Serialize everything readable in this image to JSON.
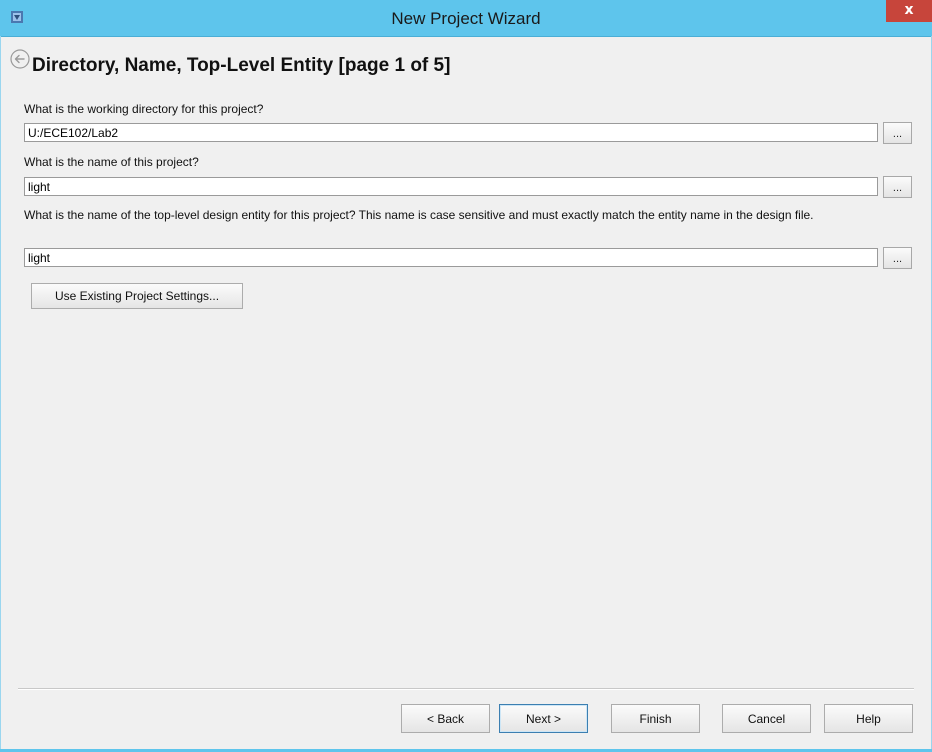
{
  "window": {
    "title": "New Project Wizard",
    "close_label": "x",
    "accent_color": "#5ec5ec"
  },
  "page": {
    "title": "Directory, Name, Top-Level Entity [page 1 of 5]",
    "back_icon": "back-arrow-icon"
  },
  "fields": {
    "directory": {
      "label": "What is the working directory for this project?",
      "value": "U:/ECE102/Lab2",
      "browse_label": "..."
    },
    "project_name": {
      "label": "What is the name of this project?",
      "value": "light",
      "browse_label": "..."
    },
    "top_level_entity": {
      "label": "What is the name of the top-level design entity for this project? This name is case sensitive and must exactly match the entity name in the design file.",
      "value": "light",
      "browse_label": "..."
    }
  },
  "existing_settings_label": "Use Existing Project Settings...",
  "footer": {
    "back_label": "< Back",
    "next_label": "Next >",
    "finish_label": "Finish",
    "cancel_label": "Cancel",
    "help_label": "Help"
  }
}
